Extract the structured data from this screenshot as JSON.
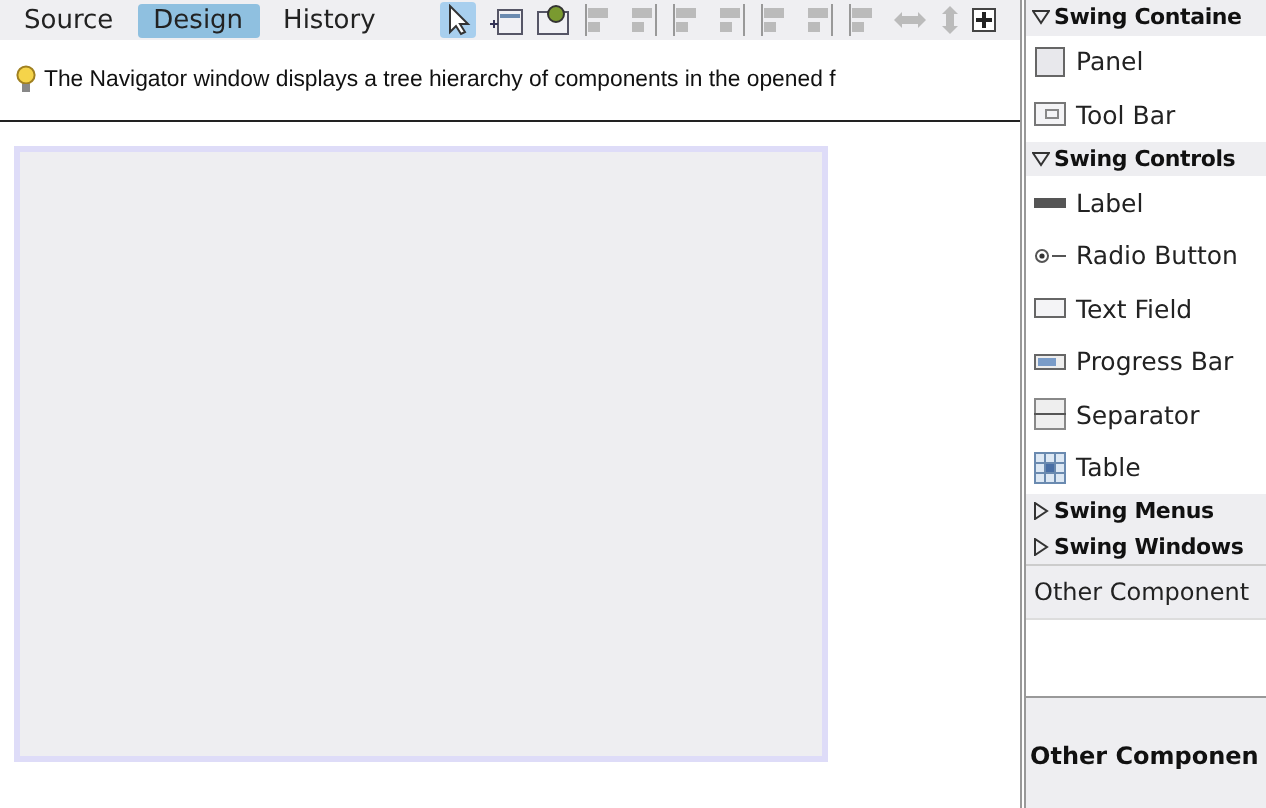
{
  "tabs": [
    {
      "label": "Source",
      "selected": false
    },
    {
      "label": "Design",
      "selected": true
    },
    {
      "label": "History",
      "selected": false
    }
  ],
  "toolbar": {
    "selection_mode": {
      "selected": true
    }
  },
  "hint": {
    "text": "The Navigator window displays a tree hierarchy of components in the opened f"
  },
  "palette": [
    {
      "kind": "category",
      "label": "Swing Containe",
      "expanded": true
    },
    {
      "kind": "item",
      "label": "Panel"
    },
    {
      "kind": "item",
      "label": "Tool Bar"
    },
    {
      "kind": "category",
      "label": "Swing Controls",
      "expanded": true
    },
    {
      "kind": "item",
      "label": "Label"
    },
    {
      "kind": "item",
      "label": "Radio Button"
    },
    {
      "kind": "item",
      "label": "Text Field"
    },
    {
      "kind": "item",
      "label": "Progress Bar"
    },
    {
      "kind": "item",
      "label": "Separator"
    },
    {
      "kind": "item",
      "label": "Table"
    },
    {
      "kind": "category",
      "label": "Swing Menus",
      "expanded": false
    },
    {
      "kind": "category",
      "label": "Swing Windows",
      "expanded": false
    }
  ],
  "other_panel": {
    "title": "Other Component"
  },
  "properties": {
    "title": "Other Componen"
  }
}
